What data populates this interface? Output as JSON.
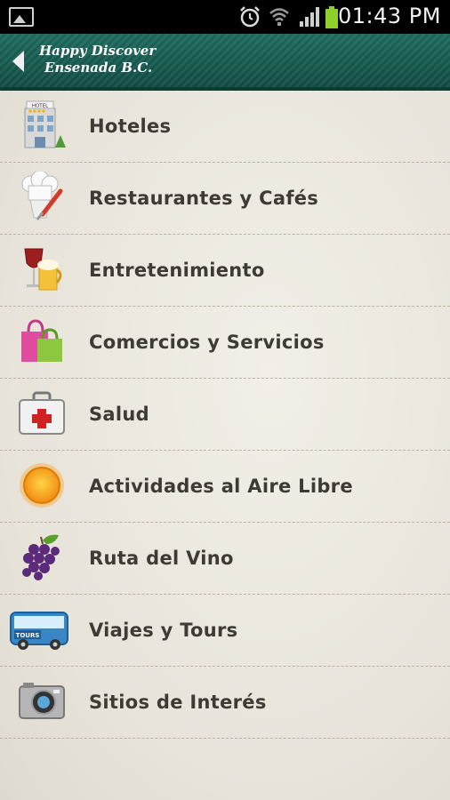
{
  "status_bar": {
    "time": "01:43 PM",
    "icons": [
      "gallery-icon",
      "alarm-icon",
      "wifi-icon",
      "signal-icon",
      "battery-icon"
    ]
  },
  "header": {
    "back_icon": "back-arrow-icon",
    "title_line1": "Happy Discover",
    "title_line2": "Ensenada B.C.",
    "color": "#1a5f55"
  },
  "menu": {
    "items": [
      {
        "label": "Hoteles",
        "icon": "hotel-icon"
      },
      {
        "label": "Restaurantes y Cafés",
        "icon": "chef-icon"
      },
      {
        "label": "Entretenimiento",
        "icon": "drinks-icon"
      },
      {
        "label": "Comercios y Servicios",
        "icon": "shopping-bag-icon"
      },
      {
        "label": "Salud",
        "icon": "first-aid-icon"
      },
      {
        "label": "Actividades al Aire Libre",
        "icon": "sun-icon"
      },
      {
        "label": "Ruta del Vino",
        "icon": "grapes-icon"
      },
      {
        "label": "Viajes y Tours",
        "icon": "tour-bus-icon"
      },
      {
        "label": "Sitios de Interés",
        "icon": "camera-icon"
      }
    ],
    "hotel_sign": "HOTEL",
    "bus_sign": "TOURS"
  }
}
